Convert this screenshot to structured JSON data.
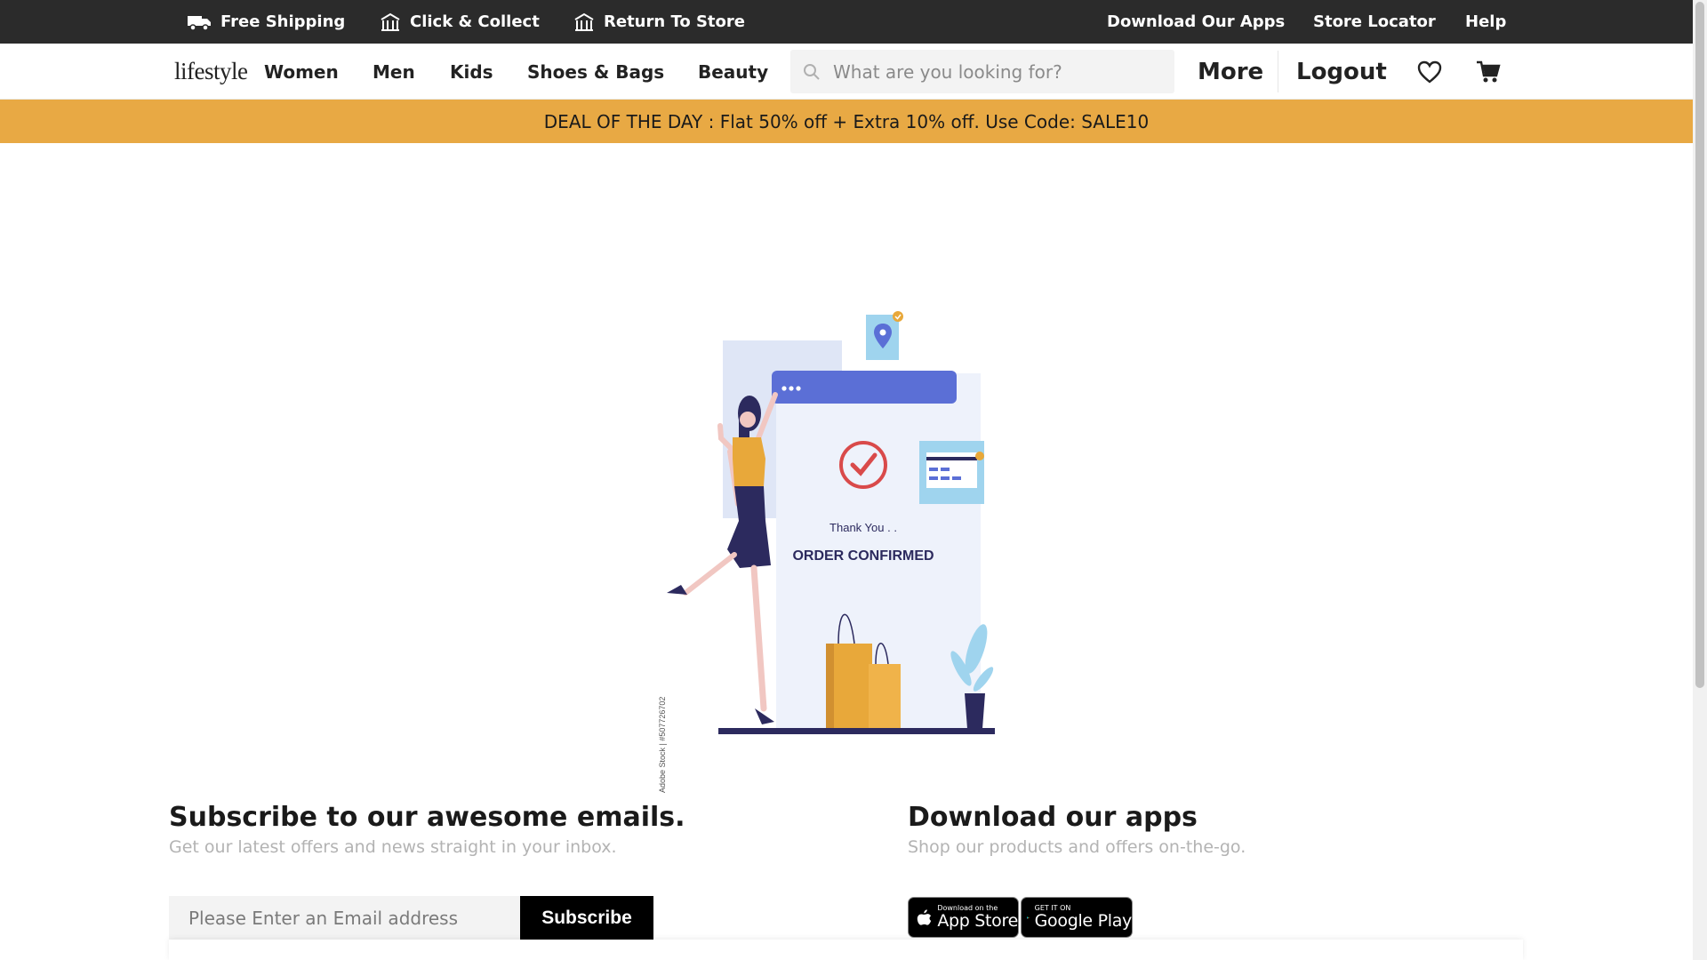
{
  "topbar": {
    "free_shipping": "Free Shipping",
    "click_collect": "Click & Collect",
    "return_store": "Return To Store",
    "download_apps": "Download Our Apps",
    "store_locator": "Store Locator",
    "help": "Help"
  },
  "nav": {
    "logo": "lifestyle",
    "women": "Women",
    "men": "Men",
    "kids": "Kids",
    "shoes_bags": "Shoes & Bags",
    "beauty": "Beauty",
    "search_placeholder": "What are you looking for?",
    "more": "More",
    "logout": "Logout"
  },
  "deal": {
    "text": "DEAL OF THE DAY : Flat 50% off + Extra 10% off. Use Code: SALE10"
  },
  "illustration": {
    "thank_you": "Thank You . .",
    "order_confirmed": "ORDER CONFIRMED",
    "stock_credit": "Adobe Stock | #507726702"
  },
  "subscribe": {
    "title": "Subscribe to our awesome emails.",
    "description": "Get our latest offers and news straight in your inbox.",
    "email_placeholder": "Please Enter an Email address",
    "button": "Subscribe"
  },
  "apps": {
    "title": "Download our apps",
    "description": "Shop our products and offers on-the-go.",
    "appstore_small": "Download on the",
    "appstore_big": "App Store",
    "googleplay_small": "GET IT ON",
    "googleplay_big": "Google Play"
  },
  "colors": {
    "topbar": "#2b2b2b",
    "deal_banner": "#e8a944",
    "illustration_blue": "#5b6fd6",
    "illustration_red": "#d94a4a",
    "illustration_orange": "#e8a83a",
    "illustration_navy": "#2c2a5e"
  }
}
